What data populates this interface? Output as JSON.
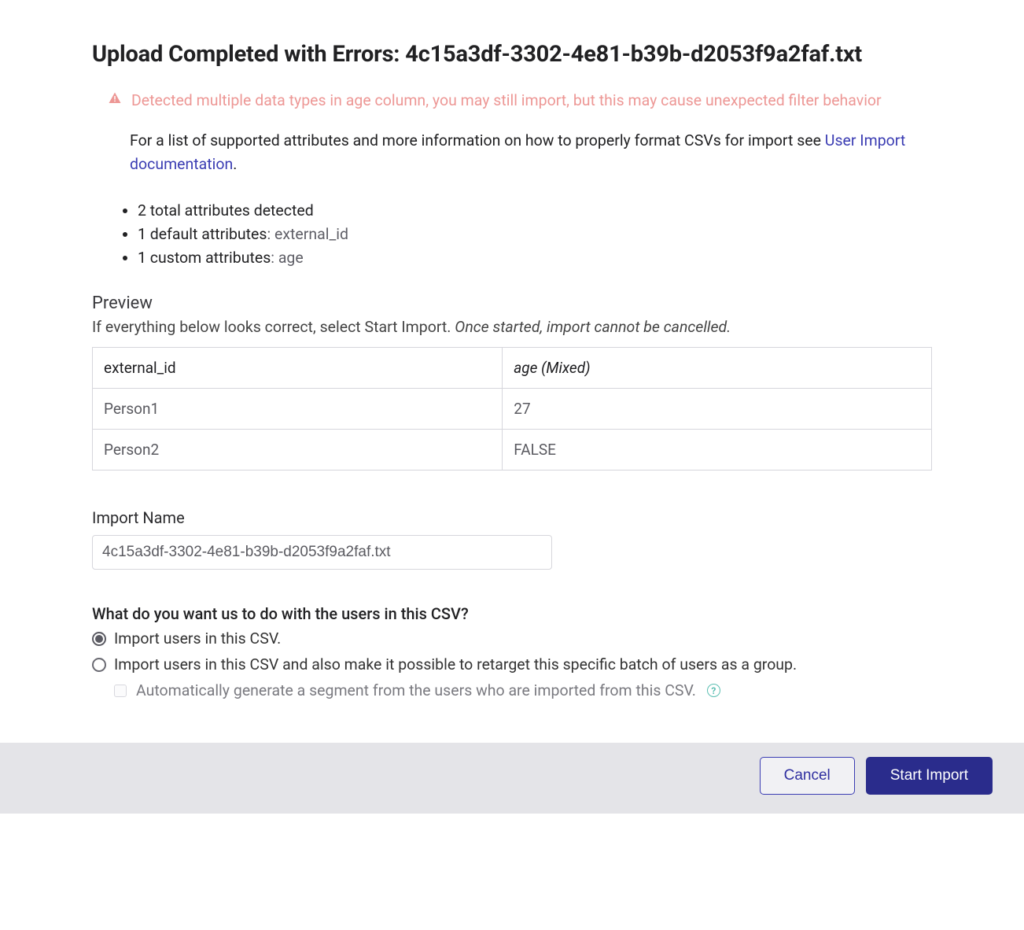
{
  "title": "Upload Completed with Errors: 4c15a3df-3302-4e81-b39b-d2053f9a2faf.txt",
  "warning": {
    "icon": "warning-icon",
    "text": "Detected multiple data types in age column, you may still import, but this may cause unexpected filter behavior"
  },
  "help": {
    "prefix": "For a list of supported attributes and more information on how to properly format CSVs for import see ",
    "link_text": "User Import documentation",
    "suffix": "."
  },
  "attributes": {
    "total": "2 total attributes detected",
    "default_label": "1 default attributes",
    "default_value": ": external_id",
    "custom_label": "1 custom attributes",
    "custom_value": ": age"
  },
  "preview": {
    "heading": "Preview",
    "instruction_plain": "If everything below looks correct, select Start Import. ",
    "instruction_em": "Once started, import cannot be cancelled.",
    "columns": [
      "external_id",
      "age (Mixed)"
    ],
    "rows": [
      {
        "c0": "Person1",
        "c1": "27"
      },
      {
        "c0": "Person2",
        "c1": "FALSE"
      }
    ]
  },
  "import_name": {
    "label": "Import Name",
    "value": "4c15a3df-3302-4e81-b39b-d2053f9a2faf.txt"
  },
  "what_to_do": {
    "heading": "What do you want us to do with the users in this CSV?",
    "option1": "Import users in this CSV.",
    "option2": "Import users in this CSV and also make it possible to retarget this specific batch of users as a group.",
    "checkbox_label": "Automatically generate a segment from the users who are imported from this CSV.",
    "selected": "option1"
  },
  "footer": {
    "cancel": "Cancel",
    "start": "Start Import"
  }
}
